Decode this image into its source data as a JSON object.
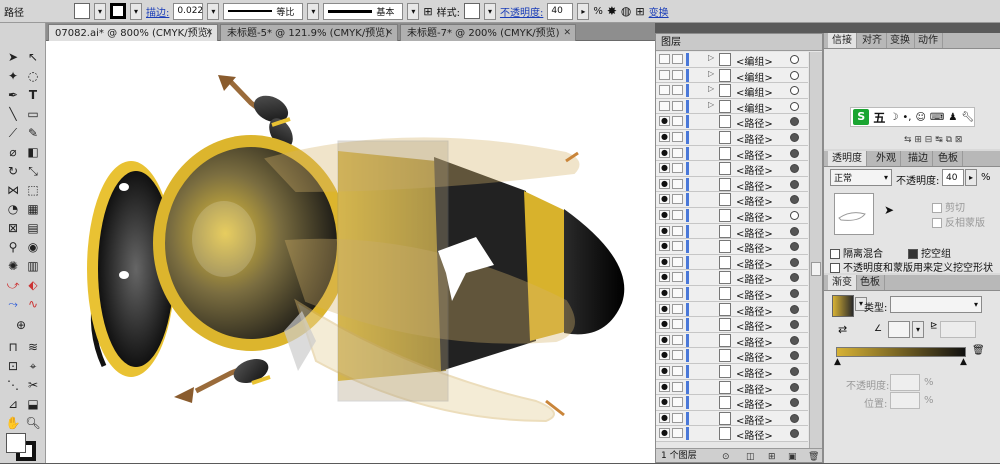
{
  "control_bar": {
    "object_type": "路径",
    "stroke_label": "描边:",
    "stroke_weight": "0.022",
    "profile": "等比",
    "brush": "基本",
    "style_label": "样式:",
    "opacity_label": "不透明度:",
    "opacity_value": "40",
    "opacity_unit": "%",
    "transform_label": "变换"
  },
  "tabs": [
    {
      "label": "07082.ai* @ 800% (CMYK/预览)",
      "close": "✕"
    },
    {
      "label": "未标题-5* @ 121.9% (CMYK/预览)",
      "close": "✕"
    },
    {
      "label": "未标题-7* @ 200% (CMYK/预览)",
      "close": "✕"
    }
  ],
  "layers": {
    "title": "图层",
    "rows": [
      {
        "name": "<编组>",
        "expand": "▷",
        "visible": "",
        "filled": false
      },
      {
        "name": "<编组>",
        "expand": "▷",
        "visible": "",
        "filled": false
      },
      {
        "name": "<编组>",
        "expand": "▷",
        "visible": "",
        "filled": false
      },
      {
        "name": "<编组>",
        "expand": "▷",
        "visible": "",
        "filled": false
      },
      {
        "name": "<路径>",
        "expand": "",
        "visible": "●",
        "filled": true
      },
      {
        "name": "<路径>",
        "expand": "",
        "visible": "●",
        "filled": true
      },
      {
        "name": "<路径>",
        "expand": "",
        "visible": "●",
        "filled": true
      },
      {
        "name": "<路径>",
        "expand": "",
        "visible": "●",
        "filled": true
      },
      {
        "name": "<路径>",
        "expand": "",
        "visible": "●",
        "filled": true
      },
      {
        "name": "<路径>",
        "expand": "",
        "visible": "●",
        "filled": true
      },
      {
        "name": "<路径>",
        "expand": "",
        "visible": "●",
        "filled": false
      },
      {
        "name": "<路径>",
        "expand": "",
        "visible": "●",
        "filled": true
      },
      {
        "name": "<路径>",
        "expand": "",
        "visible": "●",
        "filled": true
      },
      {
        "name": "<路径>",
        "expand": "",
        "visible": "●",
        "filled": true
      },
      {
        "name": "<路径>",
        "expand": "",
        "visible": "●",
        "filled": true
      },
      {
        "name": "<路径>",
        "expand": "",
        "visible": "●",
        "filled": true
      },
      {
        "name": "<路径>",
        "expand": "",
        "visible": "●",
        "filled": true
      },
      {
        "name": "<路径>",
        "expand": "",
        "visible": "●",
        "filled": true
      },
      {
        "name": "<路径>",
        "expand": "",
        "visible": "●",
        "filled": true
      },
      {
        "name": "<路径>",
        "expand": "",
        "visible": "●",
        "filled": true
      },
      {
        "name": "<路径>",
        "expand": "",
        "visible": "●",
        "filled": true
      },
      {
        "name": "<路径>",
        "expand": "",
        "visible": "●",
        "filled": true
      },
      {
        "name": "<路径>",
        "expand": "",
        "visible": "●",
        "filled": true
      },
      {
        "name": "<路径>",
        "expand": "",
        "visible": "●",
        "filled": true
      },
      {
        "name": "<路径>",
        "expand": "",
        "visible": "●",
        "filled": true
      }
    ],
    "footer": "1 个图层"
  },
  "right_panel": {
    "tabs_top": [
      "信接",
      "对齐",
      "变换",
      "动作"
    ],
    "ime": {
      "logo": "S",
      "label": "五"
    },
    "transparency": {
      "tabs": [
        "透明度",
        "外观",
        "描边",
        "色板"
      ],
      "blend_mode": "正常",
      "opacity_label": "不透明度:",
      "opacity_value": "40",
      "opacity_unit": "%",
      "clip_label": "剪切",
      "invert_mask_label": "反相蒙版",
      "isolate_label": "隔离混合",
      "knockout_label": "挖空组",
      "define_knockout_label": "不透明度和蒙版用来定义挖空形状"
    },
    "gradient": {
      "tabs": [
        "渐变",
        "色板"
      ],
      "type_label": "类型:",
      "opacity_label": "不透明度:",
      "location_label": "位置:",
      "percent": "%"
    }
  },
  "colors": {
    "accent": "#4a78d8",
    "bee_yellow": "#e9c233",
    "wing_tan": "#d6b46a",
    "leg_brown": "#9a6b3a"
  }
}
